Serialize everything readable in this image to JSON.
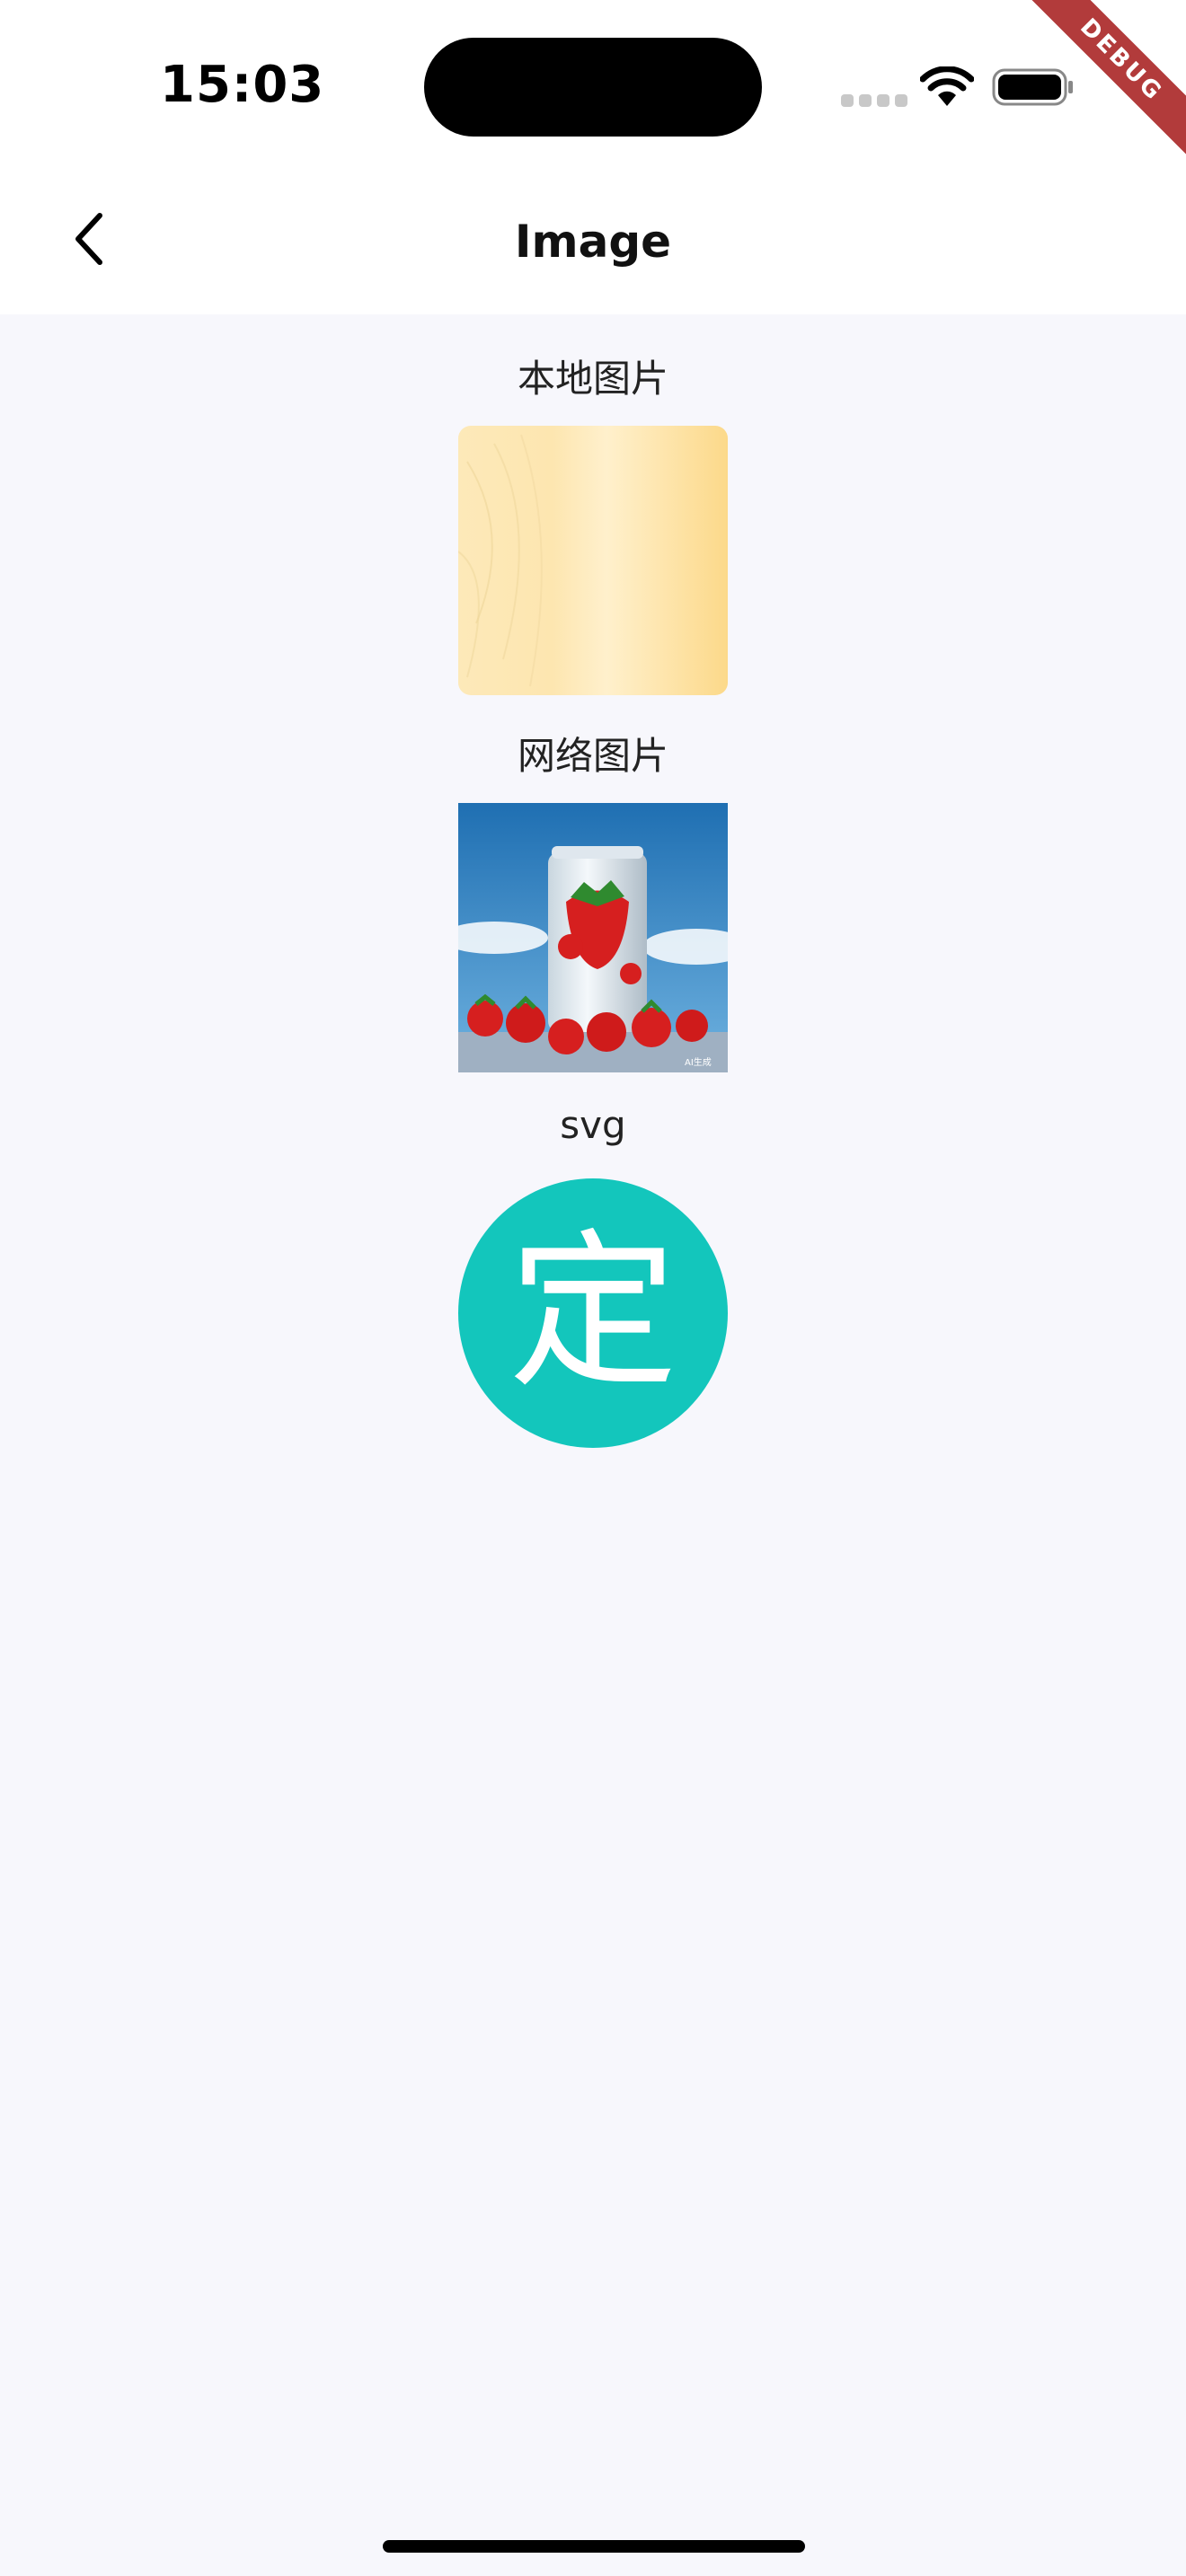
{
  "status_bar": {
    "time": "15:03",
    "debug_banner": "DEBUG",
    "icons": [
      "cellular-signal-icon",
      "wifi-icon",
      "battery-icon"
    ]
  },
  "app_bar": {
    "title": "Image",
    "back_icon": "chevron-left-icon"
  },
  "sections": {
    "local": {
      "label": "本地图片"
    },
    "network": {
      "label": "网络图片",
      "image_description": "strawberry can",
      "watermark": "AI生成"
    },
    "svg": {
      "label": "svg",
      "glyph": "定",
      "color": "#13c6bc"
    }
  },
  "colors": {
    "background": "#f7f7fc",
    "bar_background": "#ffffff",
    "debug_ribbon": "#b23b3b"
  }
}
